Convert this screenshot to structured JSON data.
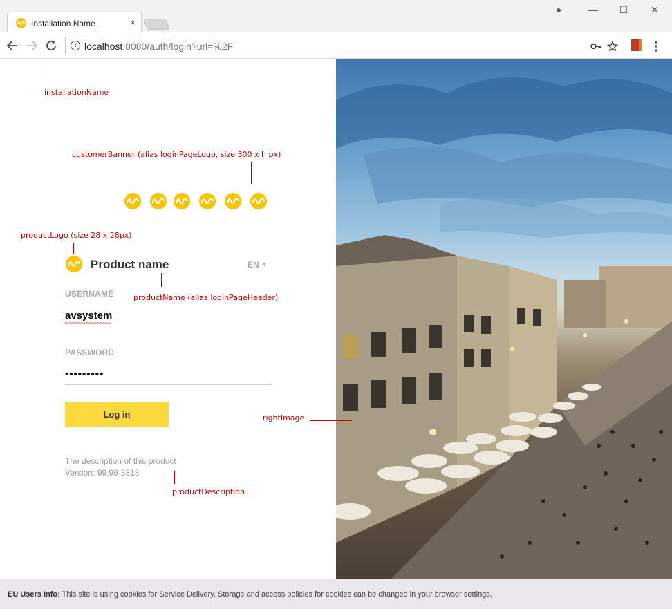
{
  "browser": {
    "tab_title": "Installation Name",
    "tab_close": "×",
    "url_host": "localhost",
    "url_rest": ":8080/auth/login?url=%2F",
    "controls": {
      "account": "●",
      "minimize": "—",
      "maximize": "☐",
      "close": "✕"
    }
  },
  "annotations": {
    "installation_name": "installationName",
    "customer_banner": "customerBanner (alias loginPageLogo, size 300 x h px)",
    "product_logo": "productLogo (size 28 x 28px)",
    "product_name": "productName (alias loginPageHeader)",
    "right_image": "rightImage",
    "product_description": "productDescription"
  },
  "login": {
    "product_name": "Product name",
    "language": "EN",
    "username_label": "USERNAME",
    "username_value": "avsystem",
    "password_label": "PASSWORD",
    "password_value": "•••••••••",
    "login_button": "Log in",
    "description": "The description of this product",
    "version": "Version: 99.99-3318"
  },
  "cookie_bar": {
    "title": "EU Users Info:",
    "text": " This site is using cookies for Service Delivery. Storage and access policies for cookies can be changed in your browser settings."
  },
  "colors": {
    "brand_yellow": "#fdd940",
    "logo_yellow": "#f6c400",
    "annotation_red": "#cc0000"
  },
  "icons": {
    "back": "arrow-left-icon",
    "forward": "arrow-right-icon",
    "reload": "reload-icon",
    "info": "info-icon",
    "key": "key-icon",
    "star": "star-icon",
    "menu": "more-vert-icon",
    "logo": "av-logo-icon"
  }
}
